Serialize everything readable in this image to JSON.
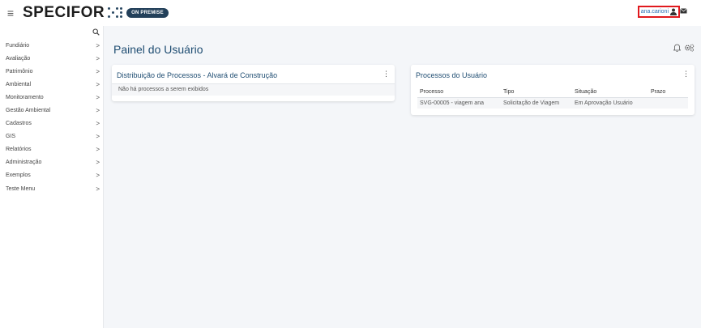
{
  "header": {
    "menu_icon": "hamburger-icon",
    "brand_name": "SPECIFOR",
    "badge": "ON PREMISE",
    "username": "ana.carioni",
    "user_icon": "user-icon",
    "mail_icon": "mail-icon",
    "highlight_color": "#e0191e"
  },
  "sidebar": {
    "search_icon": "search-icon",
    "items": [
      {
        "label": "Fundiário"
      },
      {
        "label": "Avaliação"
      },
      {
        "label": "Patrimônio"
      },
      {
        "label": "Ambiental"
      },
      {
        "label": "Monitoramento"
      },
      {
        "label": "Gestão Ambiental"
      },
      {
        "label": "Cadastros"
      },
      {
        "label": "GIS"
      },
      {
        "label": "Relatórios"
      },
      {
        "label": "Administração"
      },
      {
        "label": "Exemplos"
      },
      {
        "label": "Teste Menu"
      }
    ],
    "chevron": ">"
  },
  "main": {
    "title": "Painel do Usuário",
    "icons": [
      "bell-icon",
      "settings-icon"
    ],
    "card_distribution": {
      "title": "Distribuição de Processos - Alvará de Construção",
      "empty_message": "Não há processos a serem exibidos"
    },
    "card_processes": {
      "title": "Processos do Usuário",
      "columns": [
        "Processo",
        "Tipo",
        "Situação",
        "Prazo"
      ],
      "rows": [
        [
          "SVG-00005 - viagem ana",
          "Solicitação de Viagem",
          "Em Aprovação Usuário",
          ""
        ]
      ]
    },
    "kebab": "⋮"
  }
}
